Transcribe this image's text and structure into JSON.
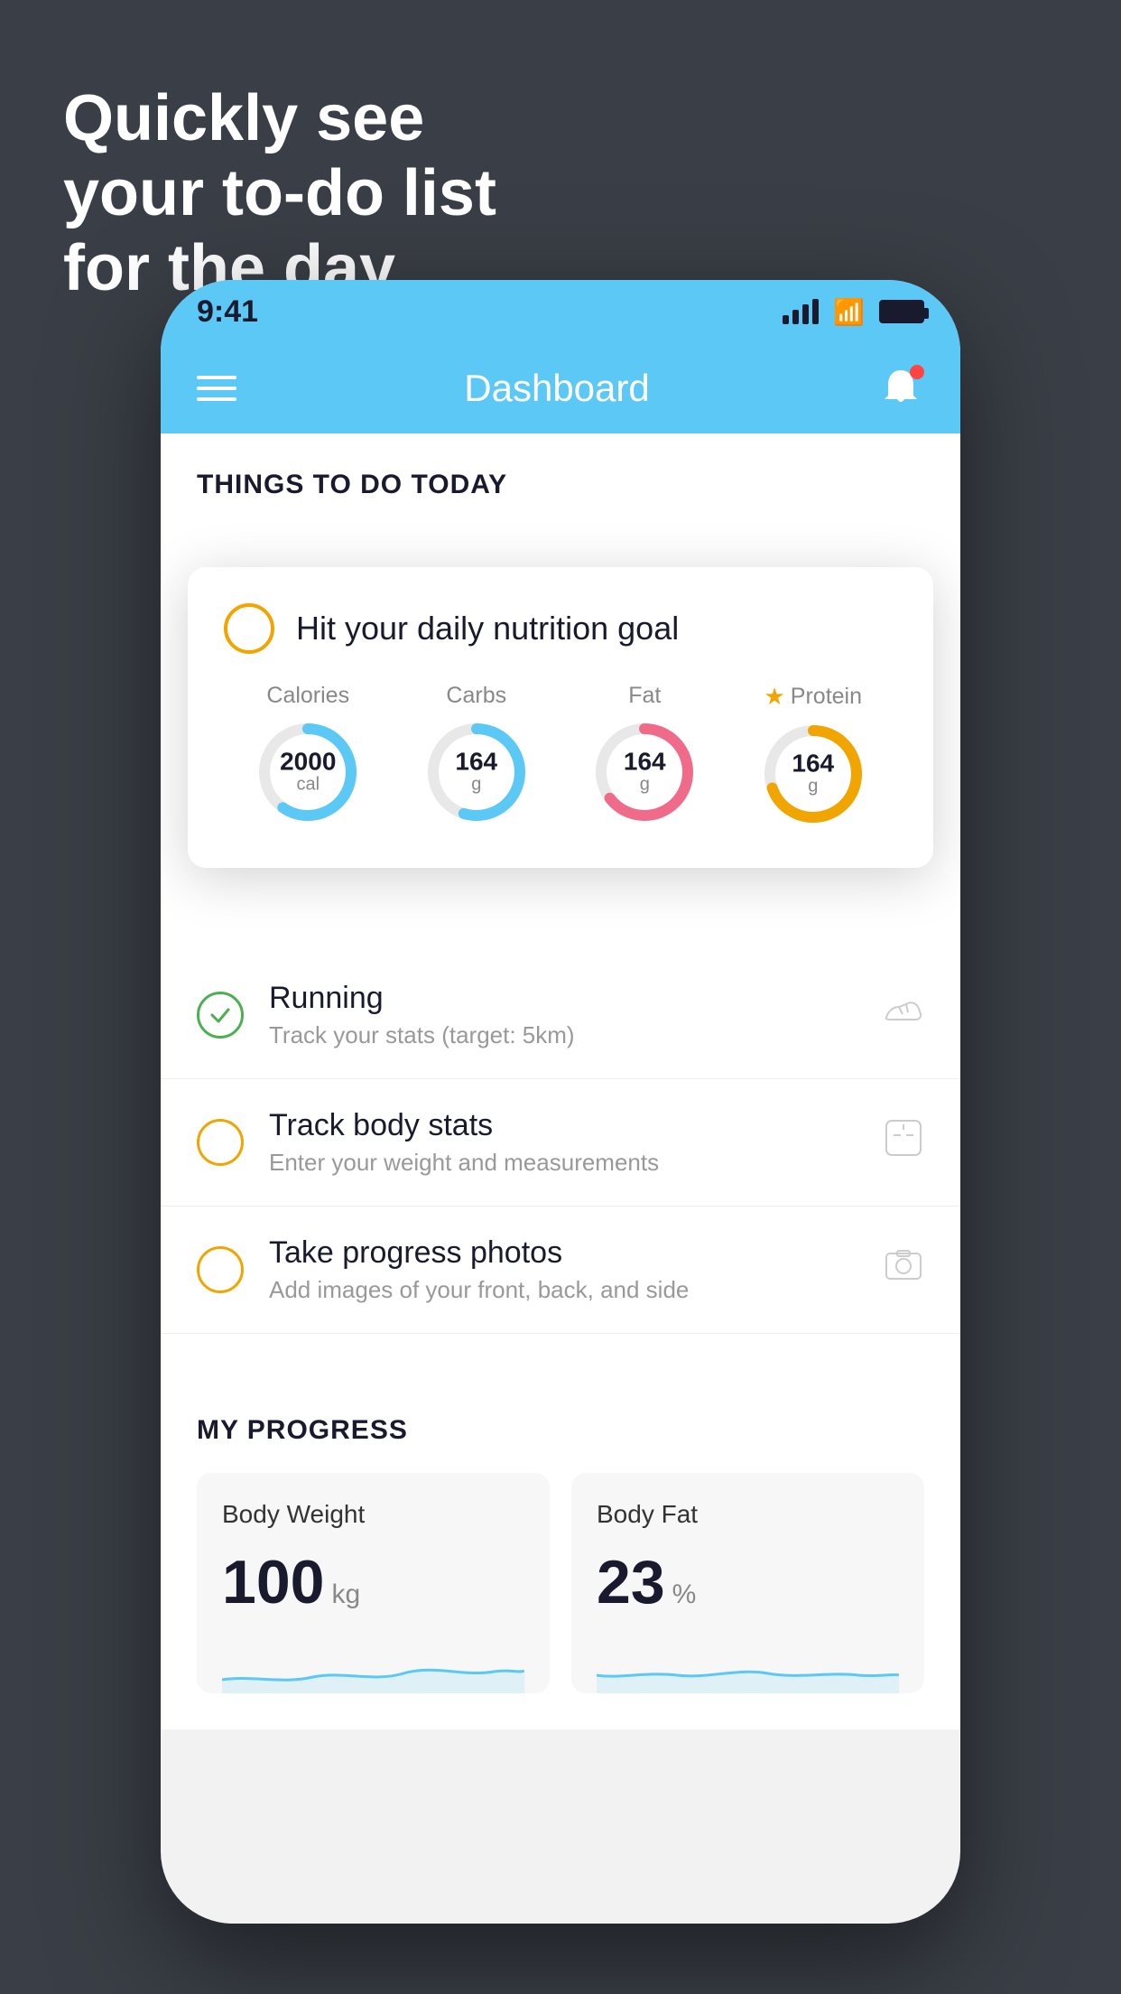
{
  "headline": {
    "line1": "Quickly see",
    "line2": "your to-do list",
    "line3": "for the day."
  },
  "phone": {
    "status_bar": {
      "time": "9:41"
    },
    "nav": {
      "title": "Dashboard"
    },
    "things_today": {
      "section_title": "THINGS TO DO TODAY"
    },
    "nutrition_card": {
      "title": "Hit your daily nutrition goal",
      "items": [
        {
          "label": "Calories",
          "value": "2000",
          "unit": "cal",
          "color": "#5bc8f5",
          "percent": 60
        },
        {
          "label": "Carbs",
          "value": "164",
          "unit": "g",
          "color": "#5bc8f5",
          "percent": 55
        },
        {
          "label": "Fat",
          "value": "164",
          "unit": "g",
          "color": "#f06a8a",
          "percent": 65
        },
        {
          "label": "Protein",
          "value": "164",
          "unit": "g",
          "color": "#f0a500",
          "percent": 70,
          "starred": true
        }
      ]
    },
    "todo_items": [
      {
        "name": "Running",
        "desc": "Track your stats (target: 5km)",
        "circle_color": "green",
        "icon": "shoe"
      },
      {
        "name": "Track body stats",
        "desc": "Enter your weight and measurements",
        "circle_color": "yellow",
        "icon": "scale"
      },
      {
        "name": "Take progress photos",
        "desc": "Add images of your front, back, and side",
        "circle_color": "yellow",
        "icon": "photo"
      }
    ],
    "progress": {
      "title": "MY PROGRESS",
      "cards": [
        {
          "title": "Body Weight",
          "value": "100",
          "unit": "kg"
        },
        {
          "title": "Body Fat",
          "value": "23",
          "unit": "%"
        }
      ]
    }
  }
}
